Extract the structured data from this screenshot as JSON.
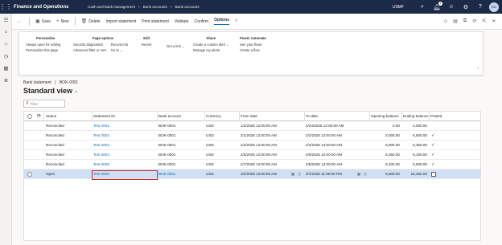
{
  "app": {
    "name": "Finance and Operations",
    "company": "USMF",
    "user_initials": "SU",
    "notification_count": "1"
  },
  "breadcrumbs": [
    "Cash and bank management",
    "Bank accounts",
    "Bank accounts"
  ],
  "action_bar": {
    "save": "Save",
    "new": "New",
    "delete": "Delete",
    "tabs": [
      "Import statement",
      "Print statement",
      "Validate",
      "Confirm",
      "Options"
    ],
    "active_tab": "Options"
  },
  "ribbon": {
    "groups": [
      {
        "title": "Personalize",
        "columns": [
          [
            "Always open for editing",
            "Personalize this page"
          ]
        ]
      },
      {
        "title": "Page options",
        "columns": [
          [
            "Security diagnostics",
            "Advanced filter or sort"
          ],
          [
            "Record info",
            "Go to"
          ]
        ]
      },
      {
        "title": "Edit",
        "columns": [
          [
            "Revert"
          ]
        ]
      },
      {
        "title": "",
        "columns": [
          [
            "Get a link"
          ]
        ]
      },
      {
        "title": "Share",
        "columns": [
          [
            "Create a custom alert",
            "Manage my alerts"
          ]
        ]
      },
      {
        "title": "Power Automate",
        "columns": [
          [
            "See your flows",
            "Create a flow"
          ]
        ]
      }
    ]
  },
  "record_crumb": {
    "form": "Bank statement",
    "sep": "|",
    "account": "BOK-0001"
  },
  "view_title": "Standard view",
  "filter": {
    "placeholder": "Filter"
  },
  "grid": {
    "headers": {
      "status": "Status",
      "statement_id": "Statement ID",
      "bank_account": "Bank account",
      "currency": "Currency",
      "from_date": "From date",
      "to_date": "To date",
      "opening_balance": "Opening balance",
      "ending_balance": "Ending balance",
      "posted": "Posted"
    },
    "rows": [
      {
        "status": "Reconciled",
        "statement_id": "Test 0001",
        "bank_account": "BOK-0001",
        "currency": "USD",
        "from_date": "1/2/2025 12:00:00 AM",
        "to_date": "1/24/2026 12:00:00 AM",
        "opening_balance": "0.00",
        "ending_balance": "2,000.00",
        "posted": ""
      },
      {
        "status": "Reconciled",
        "statement_id": "Test 0002",
        "bank_account": "BOK-0001",
        "currency": "USD",
        "from_date": "2/1/2025 12:00:00 AM",
        "to_date": "2/2/2025 12:00:00 AM",
        "opening_balance": "2,000.00",
        "ending_balance": "5,800.00",
        "posted": "✓"
      },
      {
        "status": "Reconciled",
        "statement_id": "Test 0003",
        "bank_account": "BOK-0001",
        "currency": "USD",
        "from_date": "2/3/2025 12:00:00 AM",
        "to_date": "2/4/2025 12:00:00 AM",
        "opening_balance": "5,800.00",
        "ending_balance": "6,350.00",
        "posted": "✓"
      },
      {
        "status": "Reconciled",
        "statement_id": "Test 0004",
        "bank_account": "BOK-0001",
        "currency": "USD",
        "from_date": "2/5/2025 12:00:00 AM",
        "to_date": "2/6/2025 12:00:00 AM",
        "opening_balance": "6,350.00",
        "ending_balance": "8,100.00",
        "posted": "✓"
      },
      {
        "status": "Reconciled",
        "statement_id": "Test 0005",
        "bank_account": "BOK-0001",
        "currency": "USD",
        "from_date": "2/7/2025 12:00:00 AM",
        "to_date": "2/8/2025 12:00:00 AM",
        "opening_balance": "8,100.00",
        "ending_balance": "8,600.00",
        "posted": "✓"
      },
      {
        "status": "Open",
        "statement_id": "Test 0006",
        "bank_account": "BOK-0001",
        "currency": "USD",
        "from_date": "3/2/2025 12:00:00 AM",
        "to_date": "3/1/2025 11:00:00 PM",
        "opening_balance": "8,600.00",
        "ending_balance": "16,250.00",
        "posted": ""
      }
    ],
    "selected_row_index": 5
  },
  "colors": {
    "topbar": "#1b2a47",
    "accent": "#0f6cbd",
    "selected_row": "#cfe0f5",
    "highlight_box": "#d0202a"
  }
}
